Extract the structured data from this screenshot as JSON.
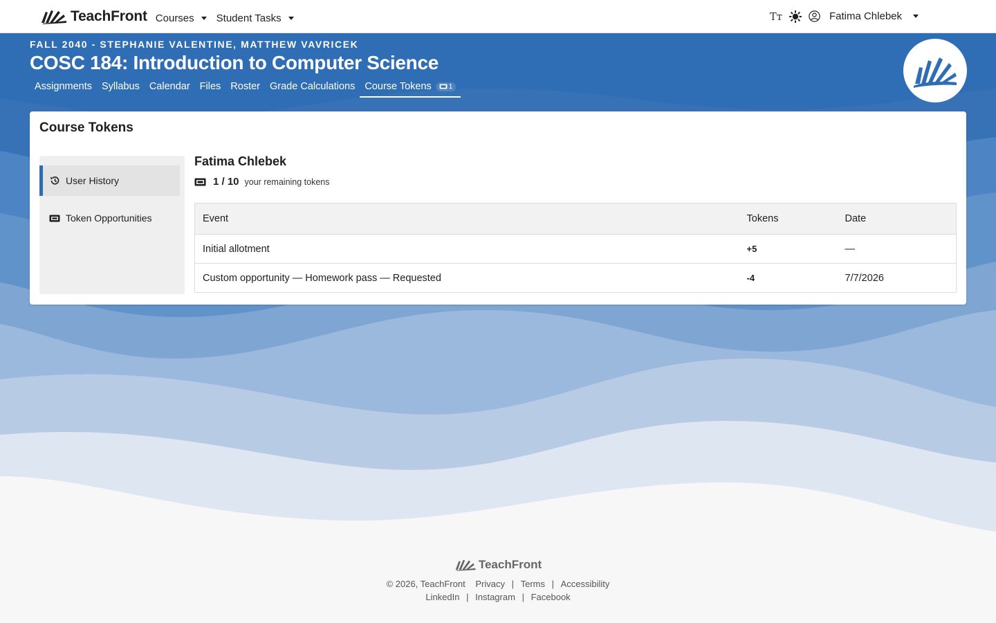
{
  "navbar": {
    "brand": "TeachFront",
    "menus": [
      {
        "label": "Courses"
      },
      {
        "label": "Student Tasks"
      }
    ],
    "text_size_icon_label": "Tт",
    "user_name": "Fatima Chlebek"
  },
  "course": {
    "term_line": "FALL 2040 - STEPHANIE VALENTINE, MATTHEW VAVRICEK",
    "title": "COSC 184: Introduction to Computer Science",
    "tabs": [
      "Assignments",
      "Syllabus",
      "Calendar",
      "Files",
      "Roster",
      "Grade Calculations"
    ],
    "active_tab": "Course Tokens",
    "active_tab_badge": "1"
  },
  "card": {
    "title": "Course Tokens",
    "sidebar": [
      {
        "label": "User History",
        "icon": "history-icon",
        "active": true
      },
      {
        "label": "Token Opportunities",
        "icon": "ticket-icon",
        "active": false
      }
    ],
    "student_name": "Fatima Chlebek",
    "remaining_count": "1 / 10",
    "remaining_label": "your remaining tokens",
    "table": {
      "headers": [
        "Event",
        "Tokens",
        "Date"
      ],
      "rows": [
        {
          "event": "Initial allotment",
          "tokens": "+5",
          "date": "—"
        },
        {
          "event": "Custom opportunity — Homework pass — Requested",
          "tokens": "-4",
          "date": "7/7/2026"
        }
      ]
    }
  },
  "footer": {
    "brand": "TeachFront",
    "copyright": "© 2026, TeachFront",
    "links_row1": [
      "Privacy",
      "Terms",
      "Accessibility"
    ],
    "links_row2": [
      "LinkedIn",
      "Instagram",
      "Facebook"
    ]
  },
  "colors": {
    "primary_blue": "#2e6db4",
    "positive": "#1c6b36",
    "negative": "#5b3bb0"
  }
}
